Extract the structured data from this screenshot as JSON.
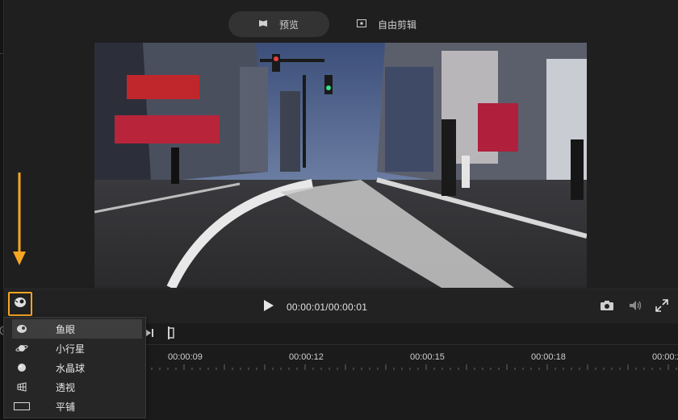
{
  "tabs": {
    "preview_label": "预览",
    "free_edit_label": "自由剪辑"
  },
  "player": {
    "timecode": "00:00:01/00:00:01"
  },
  "timeline": {
    "ticks": [
      "00:00:09",
      "00:00:12",
      "00:00:15",
      "00:00:18",
      "00:00:2"
    ]
  },
  "view_menu": {
    "items": [
      {
        "label": "鱼眼",
        "icon": "fisheye-icon",
        "selected": true
      },
      {
        "label": "小行星",
        "icon": "planet-icon",
        "selected": false
      },
      {
        "label": "水晶球",
        "icon": "crystal-ball-icon",
        "selected": false
      },
      {
        "label": "透视",
        "icon": "perspective-icon",
        "selected": false
      },
      {
        "label": "平铺",
        "icon": "flat-icon",
        "selected": false
      }
    ]
  },
  "colors": {
    "highlight": "#f5a623",
    "background": "#1f1f1f"
  }
}
